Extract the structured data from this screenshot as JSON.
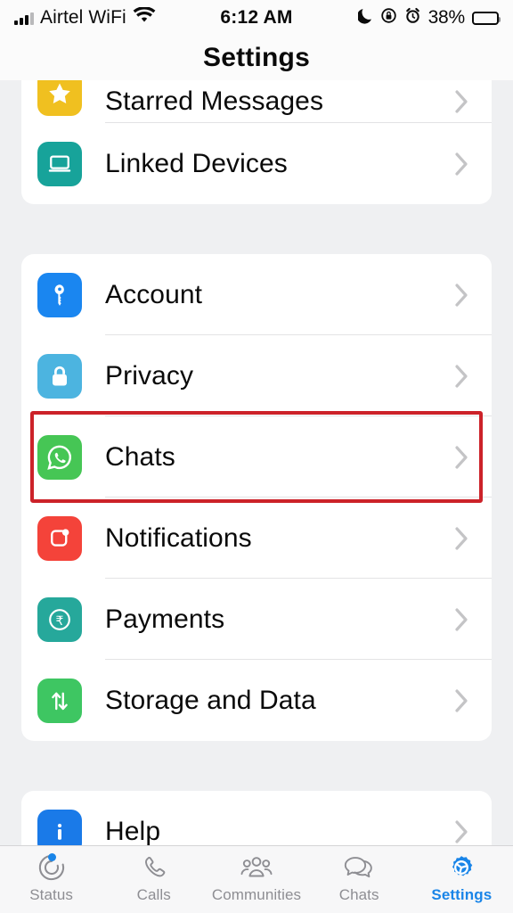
{
  "status_bar": {
    "carrier": "Airtel WiFi",
    "time": "6:12 AM",
    "battery_percent": "38%",
    "icons": [
      "signal-bars-icon",
      "wifi-icon",
      "moon-icon",
      "rotation-lock-icon",
      "alarm-icon",
      "battery-icon"
    ]
  },
  "header": {
    "title": "Settings"
  },
  "groups": [
    {
      "id": "group-top",
      "clipped": true,
      "rows": [
        {
          "label": "Starred Messages",
          "icon": "star-icon",
          "icon_color": "#f0c020",
          "clipped": true
        },
        {
          "label": "Linked Devices",
          "icon": "laptop-icon",
          "icon_color": "#17a39a"
        }
      ]
    },
    {
      "id": "group-main",
      "rows": [
        {
          "label": "Account",
          "icon": "key-icon",
          "icon_color": "#1a86f0"
        },
        {
          "label": "Privacy",
          "icon": "lock-icon",
          "icon_color": "#4cb4e0"
        },
        {
          "label": "Chats",
          "icon": "whatsapp-icon",
          "icon_color": "#46c655",
          "highlighted": true
        },
        {
          "label": "Notifications",
          "icon": "notification-badge-icon",
          "icon_color": "#f4433a"
        },
        {
          "label": "Payments",
          "icon": "rupee-circle-icon",
          "icon_color": "#26a89b"
        },
        {
          "label": "Storage and Data",
          "icon": "storage-arrows-icon",
          "icon_color": "#3ec662"
        }
      ]
    },
    {
      "id": "group-help",
      "rows": [
        {
          "label": "Help",
          "icon": "info-icon",
          "icon_color": "#1a7ae8"
        }
      ]
    }
  ],
  "highlight": {
    "color": "#cc2229",
    "target": "Chats"
  },
  "tabbar": {
    "active": "Settings",
    "active_color": "#1a85e8",
    "items": [
      {
        "label": "Status",
        "icon": "status-ring-icon",
        "badge": true
      },
      {
        "label": "Calls",
        "icon": "phone-icon",
        "badge": false
      },
      {
        "label": "Communities",
        "icon": "communities-icon",
        "badge": false
      },
      {
        "label": "Chats",
        "icon": "chat-bubbles-icon",
        "badge": false
      },
      {
        "label": "Settings",
        "icon": "gear-icon",
        "badge": false
      }
    ]
  }
}
